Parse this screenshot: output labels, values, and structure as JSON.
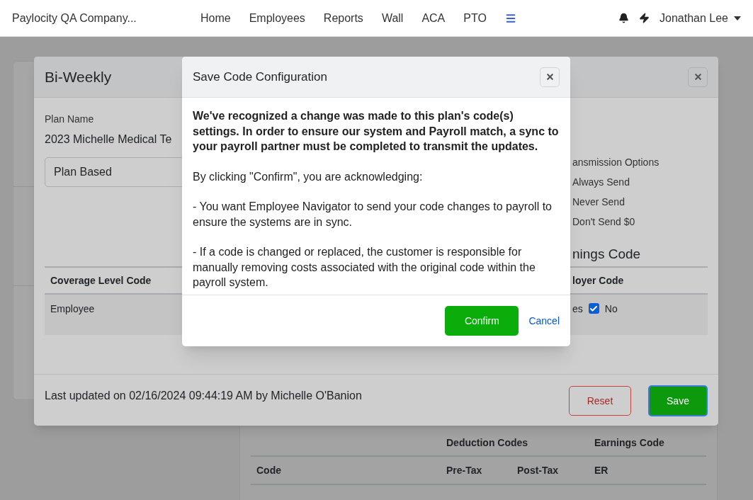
{
  "navbar": {
    "brand": "Paylocity QA Company...",
    "links": [
      "Home",
      "Employees",
      "Reports",
      "Wall",
      "ACA",
      "PTO"
    ],
    "user": "Jonathan Lee"
  },
  "codes_table": {
    "group_headers": [
      "Deduction Codes",
      "Earnings Code"
    ],
    "columns": [
      "Code",
      "Pre-Tax",
      "Post-Tax",
      "ER"
    ]
  },
  "plan_dialog": {
    "title": "Bi-Weekly",
    "plan_name_label": "Plan Name",
    "plan_name": "2023 Michelle Medical Te",
    "select_value": "Plan Based",
    "transmission_label": "ansmission Options",
    "transmission_options": [
      "Always Send",
      "Never Send",
      "Don't Send $0"
    ],
    "earnings_heading": "nings Code",
    "columns": [
      "Coverage Level Code",
      "loyer Code"
    ],
    "rows": [
      {
        "coverage": "Employee",
        "option_1": "es",
        "option_2": {
          "label": "No",
          "checked": true
        }
      }
    ],
    "last_updated": "Last updated on 02/16/2024 09:44:19 AM by Michelle O'Banion",
    "reset": "Reset",
    "save": "Save"
  },
  "confirm_dialog": {
    "title": "Save Code Configuration",
    "paragraphs": [
      "We've recognized a change was made to this plan's code(s) settings. In order to ensure our system and Payroll match, a sync to your payroll partner must be completed to transmit the updates.",
      "By clicking \"Confirm\", you are acknowledging:",
      "- You want Employee Navigator to send your code changes to payroll to ensure the systems are in sync.",
      "- If a code is changed or replaced, the customer is responsible for manually removing costs associated with the original code within the payroll system."
    ],
    "confirm": "Confirm",
    "cancel": "Cancel"
  }
}
